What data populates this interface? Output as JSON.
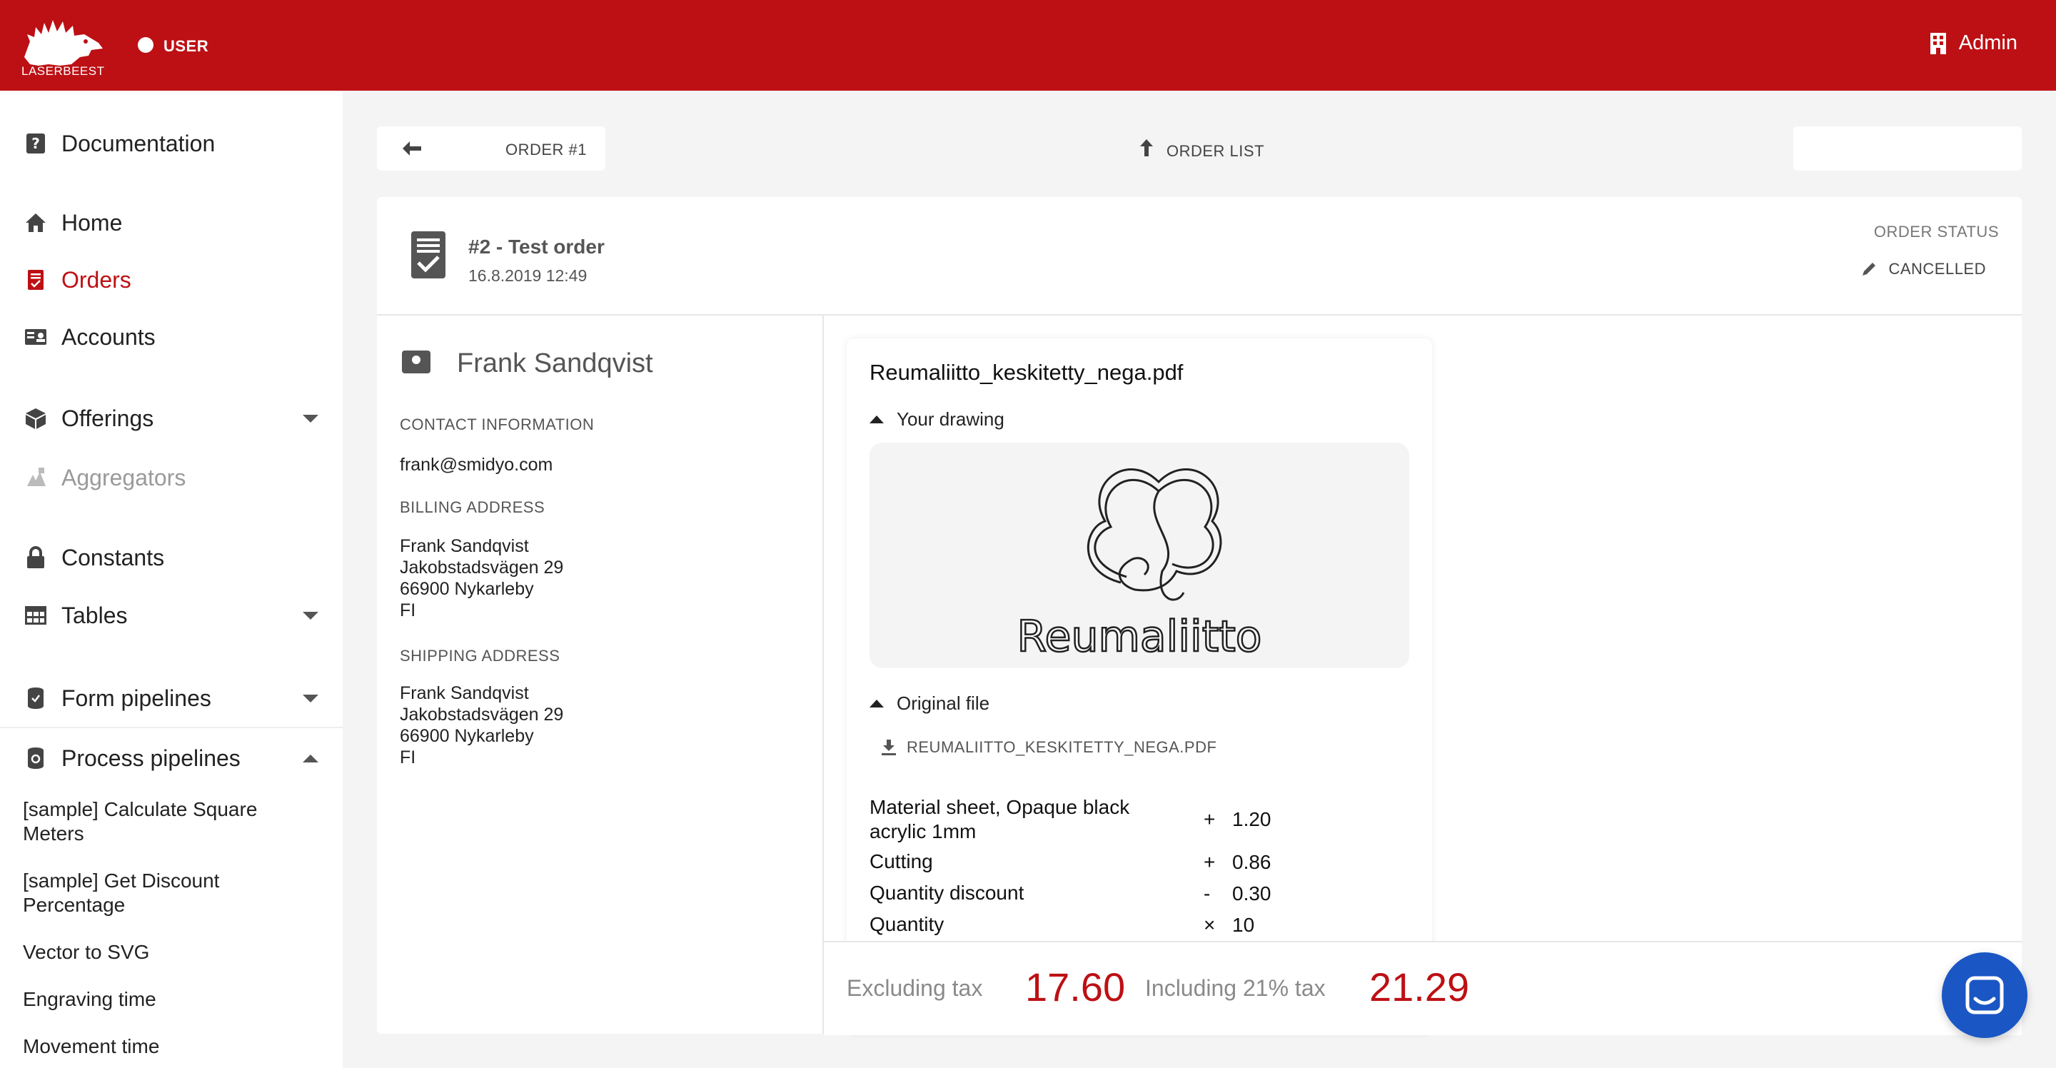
{
  "header": {
    "logo_text": "LASERBEEST",
    "user_label": "USER",
    "admin_label": "Admin"
  },
  "sidebar": {
    "items": [
      {
        "label": "Documentation",
        "icon": "question-icon"
      },
      {
        "label": "Home",
        "icon": "home-icon"
      },
      {
        "label": "Orders",
        "icon": "orders-icon",
        "active": true
      },
      {
        "label": "Accounts",
        "icon": "id-card-icon"
      },
      {
        "label": "Offerings",
        "icon": "box-icon"
      },
      {
        "label": "Aggregators",
        "icon": "aggregators-icon",
        "disabled": true
      },
      {
        "label": "Constants",
        "icon": "lock-icon"
      },
      {
        "label": "Tables",
        "icon": "table-icon"
      },
      {
        "label": "Form pipelines",
        "icon": "cylinder-icon"
      },
      {
        "label": "Process pipelines",
        "icon": "cylinder-gear-icon"
      }
    ],
    "sub_items": [
      "[sample] Calculate Square Meters",
      "[sample] Get Discount Percentage",
      "Vector to SVG",
      "Engraving time",
      "Movement time"
    ]
  },
  "toolbar": {
    "back_label": "ORDER #1",
    "center_label": "ORDER LIST"
  },
  "order": {
    "title": "#2 - Test order",
    "date": "16.8.2019 12:49",
    "status_label": "ORDER STATUS",
    "status_value": "CANCELLED"
  },
  "customer": {
    "name": "Frank Sandqvist",
    "contact_label": "CONTACT INFORMATION",
    "email": "frank@smidyo.com",
    "billing_label": "BILLING ADDRESS",
    "billing": {
      "name": "Frank Sandqvist",
      "street": "Jakobstadsvägen 29",
      "city": "66900 Nykarleby",
      "country": "FI"
    },
    "shipping_label": "SHIPPING ADDRESS",
    "shipping": {
      "name": "Frank Sandqvist",
      "street": "Jakobstadsvägen 29",
      "city": "66900 Nykarleby",
      "country": "FI"
    }
  },
  "file": {
    "name": "Reumaliitto_keskitetty_nega.pdf",
    "drawing_toggle": "Your drawing",
    "preview_text": "Reumaliitto",
    "original_toggle": "Original file",
    "download_label": "REUMALIITTO_KESKITETTY_NEGA.PDF",
    "price_rows": [
      {
        "name": "Material sheet, Opaque black acrylic 1mm",
        "op": "+",
        "value": "1.20"
      },
      {
        "name": "Cutting",
        "op": "+",
        "value": "0.86"
      },
      {
        "name": "Quantity discount",
        "op": "-",
        "value": "0.30"
      },
      {
        "name": "Quantity",
        "op": "×",
        "value": "10"
      }
    ]
  },
  "totals": {
    "excl_label": "Excluding tax",
    "excl_value": "17.60",
    "incl_label": "Including 21% tax",
    "incl_value": "21.29"
  },
  "colors": {
    "brand": "#bd1014",
    "chat": "#1a56c4"
  }
}
